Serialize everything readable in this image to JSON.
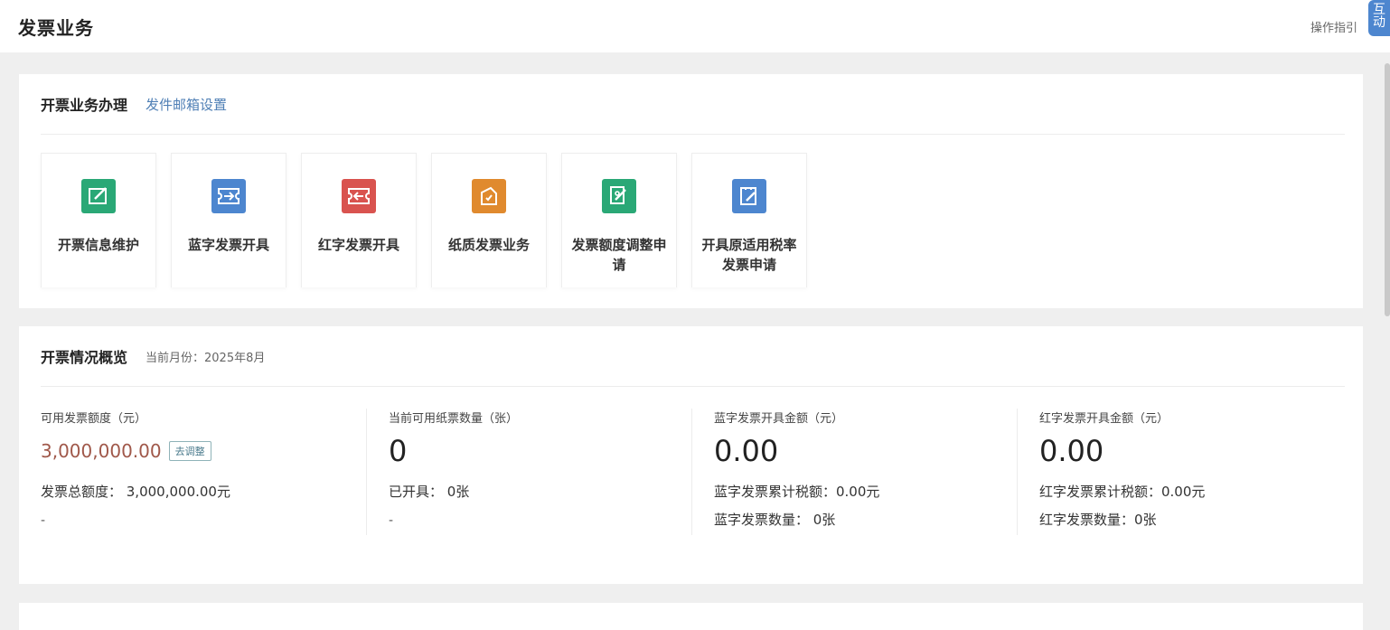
{
  "header": {
    "title": "发票业务",
    "guide": "操作指引",
    "float_tab": "互动"
  },
  "business": {
    "title": "开票业务办理",
    "email_link": "发件邮箱设置",
    "tiles": [
      {
        "label": "开票信息维护",
        "icon": "edit-icon",
        "color": "#2aa876"
      },
      {
        "label": "蓝字发票开具",
        "icon": "ticket-in-icon",
        "color": "#4d86cf"
      },
      {
        "label": "红字发票开具",
        "icon": "ticket-out-icon",
        "color": "#d9534f"
      },
      {
        "label": "纸质发票业务",
        "icon": "bag-icon",
        "color": "#e08a2e"
      },
      {
        "label": "发票额度调整申请",
        "icon": "sign-icon",
        "color": "#2aa876"
      },
      {
        "label": "开具原适用税率发票申请",
        "icon": "clipboard-icon",
        "color": "#4d86cf"
      }
    ]
  },
  "overview": {
    "title": "开票情况概览",
    "month": "当前月份：2025年8月",
    "stats": [
      {
        "label": "可用发票额度（元）",
        "value": "3,000,000.00",
        "button": "去调整",
        "lines": [
          "发票总额度：  3,000,000.00元"
        ],
        "dash": "-"
      },
      {
        "label": "当前可用纸票数量（张）",
        "value": "0",
        "lines": [
          "已开具：  0张"
        ],
        "dash": "-"
      },
      {
        "label": "蓝字发票开具金额（元）",
        "value": "0.00",
        "lines": [
          "蓝字发票累计税额：0.00元",
          "蓝字发票数量：  0张"
        ]
      },
      {
        "label": "红字发票开具金额（元）",
        "value": "0.00",
        "lines": [
          "红字发票累计税额：0.00元",
          "红字发票数量：0张"
        ]
      }
    ]
  }
}
